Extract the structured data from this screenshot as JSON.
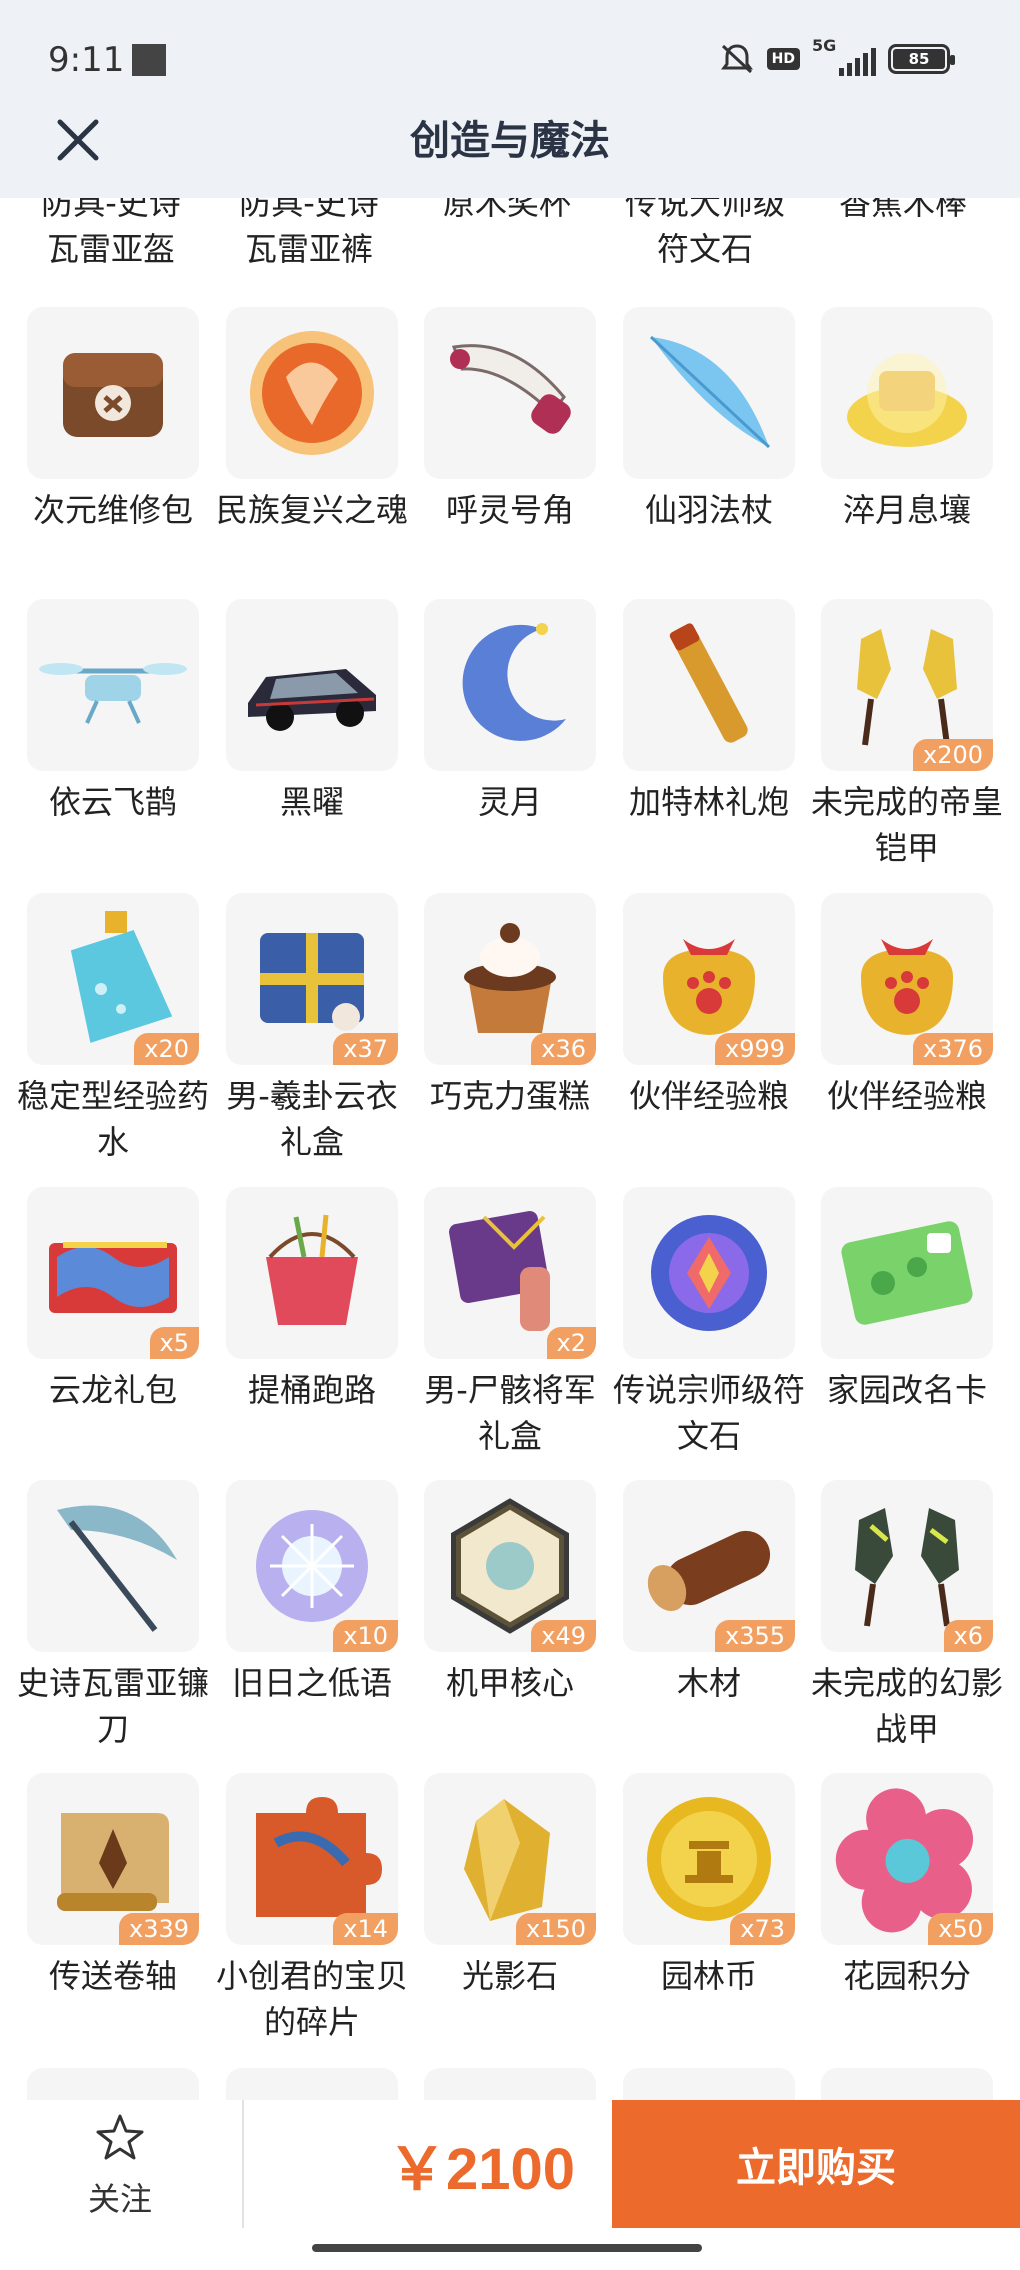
{
  "status_bar": {
    "time": "9:11",
    "network": "5G",
    "hd": "HD",
    "battery": "85"
  },
  "nav": {
    "title": "创造与魔法"
  },
  "cut_row": [
    "防具-史诗\n瓦雷亚盔",
    "防具-史诗\n瓦雷亚裤",
    "原木奖杯",
    "传说大师级\n符文石",
    "香蕉木棒"
  ],
  "items": [
    {
      "name": "次元维修包",
      "count": "",
      "icon": "repair-bag-icon",
      "color": "#7a4a2a"
    },
    {
      "name": "民族复兴之魂",
      "count": "",
      "icon": "dragon-orb-icon",
      "color": "#e9692a"
    },
    {
      "name": "呼灵号角",
      "count": "",
      "icon": "horn-icon",
      "color": "#b03055"
    },
    {
      "name": "仙羽法杖",
      "count": "",
      "icon": "feather-staff-icon",
      "color": "#7bc6f0"
    },
    {
      "name": "淬月息壤",
      "count": "",
      "icon": "gold-pile-icon",
      "color": "#f3d34b"
    },
    {
      "name": "依云飞鹊",
      "count": "",
      "icon": "drone-icon",
      "color": "#9fd3e8"
    },
    {
      "name": "黑曜",
      "count": "",
      "icon": "black-car-icon",
      "color": "#2a2a3a"
    },
    {
      "name": "灵月",
      "count": "",
      "icon": "crescent-moon-icon",
      "color": "#5a7fd6"
    },
    {
      "name": "加特林礼炮",
      "count": "",
      "icon": "cannon-icon",
      "color": "#d89a2c"
    },
    {
      "name": "未完成的帝皇铠甲",
      "count": "x200",
      "icon": "emperor-armor-icon",
      "color": "#e8c23a"
    },
    {
      "name": "稳定型经验药水",
      "count": "x20",
      "icon": "potion-icon",
      "color": "#5cc8e0"
    },
    {
      "name": "男-羲卦云衣礼盒",
      "count": "x37",
      "icon": "gift-box-icon",
      "color": "#3a5fa8"
    },
    {
      "name": "巧克力蛋糕",
      "count": "x36",
      "icon": "chocolate-cake-icon",
      "color": "#6b3a1f"
    },
    {
      "name": "伙伴经验粮",
      "count": "x999",
      "icon": "paw-sack-icon",
      "color": "#e8b22c"
    },
    {
      "name": "伙伴经验粮",
      "count": "x376",
      "icon": "paw-sack-icon",
      "color": "#e8b22c"
    },
    {
      "name": "云龙礼包",
      "count": "x5",
      "icon": "dragon-pack-icon",
      "color": "#d83a3a"
    },
    {
      "name": "提桶跑路",
      "count": "",
      "icon": "bucket-icon",
      "color": "#e04a5a"
    },
    {
      "name": "男-尸骸将军礼盒",
      "count": "x2",
      "icon": "general-box-icon",
      "color": "#6a3a8a"
    },
    {
      "name": "传说宗师级符文石",
      "count": "",
      "icon": "rune-stone-icon",
      "color": "#4a5fd0"
    },
    {
      "name": "家园改名卡",
      "count": "",
      "icon": "rename-card-icon",
      "color": "#7ad36a"
    },
    {
      "name": "史诗瓦雷亚镰刀",
      "count": "",
      "icon": "scythe-icon",
      "color": "#8ab8c8"
    },
    {
      "name": "旧日之低语",
      "count": "x10",
      "icon": "crystal-orb-icon",
      "color": "#b9b0f0"
    },
    {
      "name": "机甲核心",
      "count": "x49",
      "icon": "mech-core-icon",
      "color": "#3a3a3a"
    },
    {
      "name": "木材",
      "count": "x355",
      "icon": "wood-log-icon",
      "color": "#7a3e1e"
    },
    {
      "name": "未完成的幻影战甲",
      "count": "x6",
      "icon": "phantom-armor-icon",
      "color": "#3a4a3a"
    },
    {
      "name": "传送卷轴",
      "count": "x339",
      "icon": "scroll-icon",
      "color": "#b8842c"
    },
    {
      "name": "小创君的宝贝的碎片",
      "count": "x14",
      "icon": "puzzle-piece-icon",
      "color": "#d85a2a"
    },
    {
      "name": "光影石",
      "count": "x150",
      "icon": "light-stone-icon",
      "color": "#e0b030"
    },
    {
      "name": "园林币",
      "count": "x73",
      "icon": "garden-coin-icon",
      "color": "#e8b820"
    },
    {
      "name": "花园积分",
      "count": "x50",
      "icon": "flower-badge-icon",
      "color": "#e8608a"
    }
  ],
  "bottom": {
    "follow_label": "关注",
    "price": "￥2100",
    "buy_label": "立即购买"
  },
  "colors": {
    "accent": "#ec6a2c",
    "badge": "#f1a061",
    "header_bg": "#eef2f7",
    "tile_bg": "#f5f5f5"
  }
}
